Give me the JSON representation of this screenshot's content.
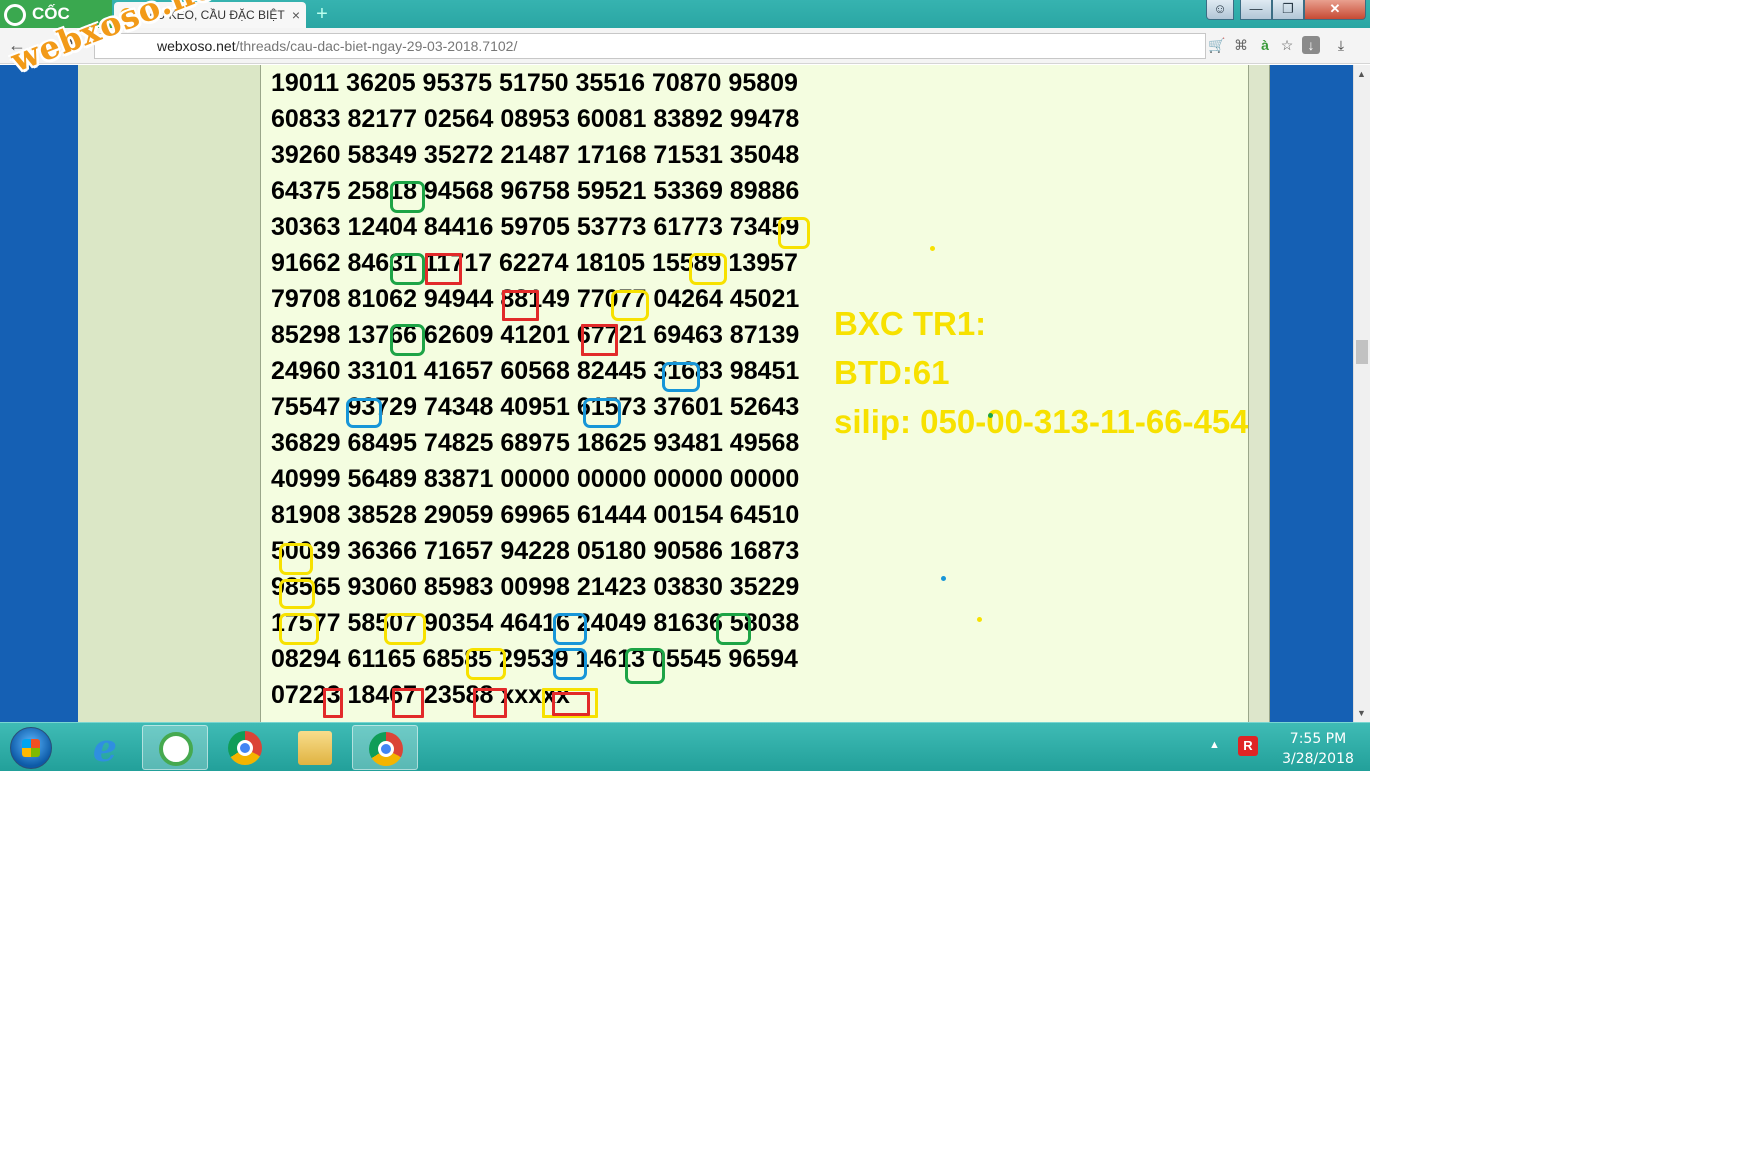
{
  "browser": {
    "brand": "CỐC CỐC",
    "tab": {
      "favicon": "xs",
      "title": "CẦU KÉO, CẦU ĐẶC BIỆT",
      "close": "×"
    },
    "new_tab": "+",
    "window_controls": {
      "user": "☺",
      "minimize": "—",
      "maximize": "❐",
      "close": "✕"
    },
    "nav": {
      "back": "←",
      "forward": "→",
      "reload": "↻"
    },
    "url": {
      "host": "webxoso.net",
      "path": "/threads/cau-dac-biet-ngay-29-03-2018.7102/"
    },
    "icons": [
      "cart-icon",
      "translate-icon",
      "a-icon",
      "star-icon",
      "download-page-icon",
      "download-icon"
    ]
  },
  "watermark": "webxoso.net",
  "grid_rows": [
    "19011 36205 95375 51750 35516 70870 95809",
    "60833 82177 02564 08953 60081 83892 99478",
    "39260 58349 35272 21487 17168 71531 35048",
    "64375 25818 94568 96758 59521 53369 89886",
    "30363 12404 84416 59705 53773 61773 73459",
    "91662 84631 11717 62274 18105 15589 13957",
    "79708 81062 94944 88149 77077 04264 45021",
    "85298 13766 62609 41201 67721 69463 87139",
    "24960 33101 41657 60568 82445 31683 98451",
    "75547 93729 74348 40951 61573 37601 52643",
    "36829 68495 74825 68975 18625 93481 49568",
    "40999 56489 83871 00000 00000 00000 00000",
    "81908 38528 29059 69965 61444 00154 64510",
    "50039 36366 71657 94228 05180 90586 16873",
    "98565 93060 85983 00998 21423 03830 35229",
    "17577 58507 90354 46416 24049 81636 58038",
    "08294 61165 68585 29539 14613 05545 96594",
    "07223 18467 23588 xxxxx"
  ],
  "notes": [
    "BXC TR1:",
    "BTD:61",
    "silip: 050-00-313-11-66-454"
  ],
  "colors": {
    "green": "#1da446",
    "yellow": "#f7e100",
    "red": "#e22a2a",
    "blue": "#1796d8",
    "page_bg": "#1560b4",
    "content_bg": "#f4fde0"
  },
  "scrollbar": {
    "up": "▲",
    "down": "▼"
  },
  "taskbar": {
    "start": "windows-start-icon",
    "apps": [
      "internet-explorer-icon",
      "coccoc-icon",
      "chrome-icon",
      "file-explorer-icon",
      "chrome-icon"
    ],
    "tray_arrow": "▲",
    "tray_app": "R",
    "time": "7:55 PM",
    "date": "3/28/2018"
  }
}
